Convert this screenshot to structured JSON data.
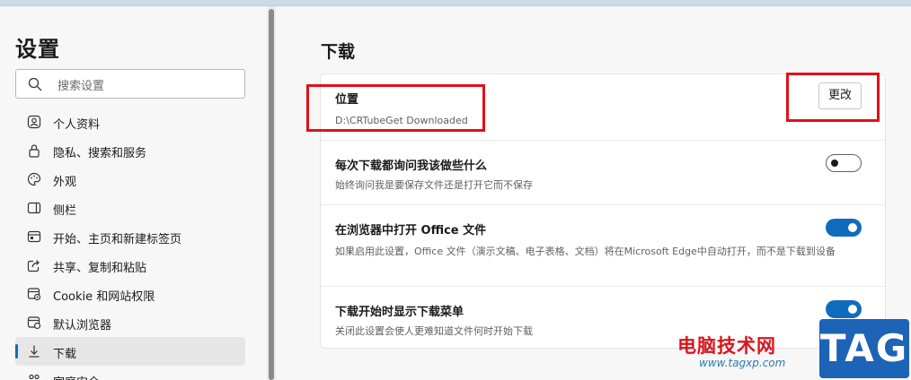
{
  "sidebar": {
    "title": "设置",
    "search": {
      "placeholder": "搜索设置"
    },
    "items": [
      {
        "label": "个人资料",
        "icon": "profile-icon"
      },
      {
        "label": "隐私、搜索和服务",
        "icon": "lock-icon"
      },
      {
        "label": "外观",
        "icon": "palette-icon"
      },
      {
        "label": "侧栏",
        "icon": "sidebar-icon"
      },
      {
        "label": "开始、主页和新建标签页",
        "icon": "home-tab-icon"
      },
      {
        "label": "共享、复制和粘贴",
        "icon": "share-icon"
      },
      {
        "label": "Cookie 和网站权限",
        "icon": "site-permissions-icon"
      },
      {
        "label": "默认浏览器",
        "icon": "browser-icon"
      },
      {
        "label": "下载",
        "icon": "download-icon",
        "active": true
      },
      {
        "label": "家庭安全",
        "icon": "family-icon"
      }
    ]
  },
  "main": {
    "section_title": "下载",
    "location": {
      "title": "位置",
      "path": "D:\\CRTubeGet Downloaded",
      "change_label": "更改"
    },
    "settings": [
      {
        "title": "每次下载都询问我该做些什么",
        "description": "始终询问我是要保存文件还是打开它而不保存",
        "enabled": false
      },
      {
        "title": "在浏览器中打开 Office 文件",
        "description": "如果启用此设置，Office 文件（演示文稿、电子表格、文档）将在Microsoft Edge中自动打开，而不是下载到设备",
        "enabled": true
      },
      {
        "title": "下载开始时显示下载菜单",
        "description": "关闭此设置会使人更难知道文件何时开始下载",
        "enabled": true
      }
    ]
  },
  "colors": {
    "accent": "#0f6cbd",
    "annotation": "#e0101a",
    "watermark_red": "#d8161c",
    "watermark_blue": "#1d63b6"
  },
  "watermark": {
    "site_name": "电脑技术网",
    "url": "www.tagxp.com",
    "tag": "TAG"
  }
}
